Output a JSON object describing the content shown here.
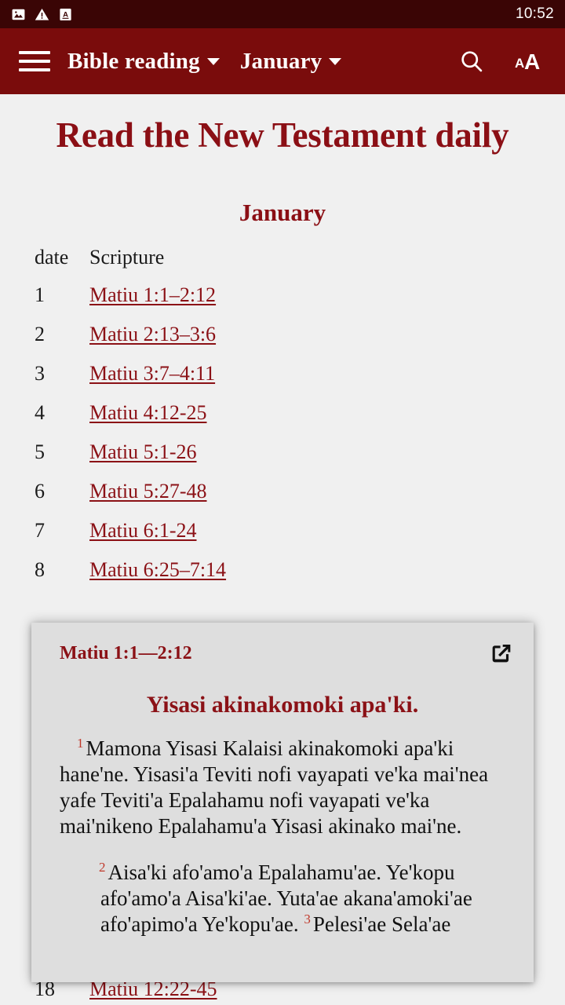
{
  "status_bar": {
    "icons": [
      "image-icon",
      "warning-icon",
      "letter-a-box-icon"
    ],
    "clock": "10:52",
    "background": "#3a0505"
  },
  "app_bar": {
    "background": "#7a0c0c",
    "menu_icon": "hamburger-menu-icon",
    "section_label": "Bible reading",
    "month_label": "January",
    "search_icon": "search-icon",
    "text_size_icon": "text-size-icon"
  },
  "page": {
    "title": "Read the New Testament daily",
    "month_heading": "January",
    "accent_color": "#8b1116",
    "background": "#f0f0f0",
    "table": {
      "headers": [
        "date",
        "Scripture"
      ],
      "rows": [
        {
          "date": "1",
          "scripture": "Matiu 1:1–2:12"
        },
        {
          "date": "2",
          "scripture": "Matiu 2:13–3:6"
        },
        {
          "date": "3",
          "scripture": "Matiu 3:7–4:11"
        },
        {
          "date": "4",
          "scripture": "Matiu 4:12-25"
        },
        {
          "date": "5",
          "scripture": "Matiu 5:1-26"
        },
        {
          "date": "6",
          "scripture": "Matiu 5:27-48"
        },
        {
          "date": "7",
          "scripture": "Matiu 6:1-24"
        },
        {
          "date": "8",
          "scripture": "Matiu 6:25–7:14"
        }
      ],
      "row_behind_panel": {
        "date": "18",
        "scripture": "Matiu 12:22-45"
      }
    }
  },
  "verse_panel": {
    "background": "#dedede",
    "reference": "Matiu 1:1—2:12",
    "open_icon": "external-link-icon",
    "heading": "Yisasi akinakomoki apa'ki.",
    "paragraphs": [
      {
        "verse": "1",
        "indented": false,
        "text": "Mamona Yisasi Kalaisi akinakomoki apa'ki hane'ne. Yisasi'a Teviti nofi vayapati ve'ka mai'nea yafe Teviti'a Epalahamu nofi vayapati ve'ka mai'nikeno Epalahamu'a Yisasi akinako mai'ne."
      },
      {
        "verse": "2",
        "indented": true,
        "text": "Aisa'ki afo'amo'a Epalahamu'ae. Ye'kopu afo'amo'a Aisa'ki'ae. Yuta'ae akana'amoki'ae afo'apimo'a Ye'kopu'ae."
      },
      {
        "verse": "3",
        "indented": true,
        "inline": true,
        "text": "Pelesi'ae Sela'ae"
      }
    ]
  }
}
